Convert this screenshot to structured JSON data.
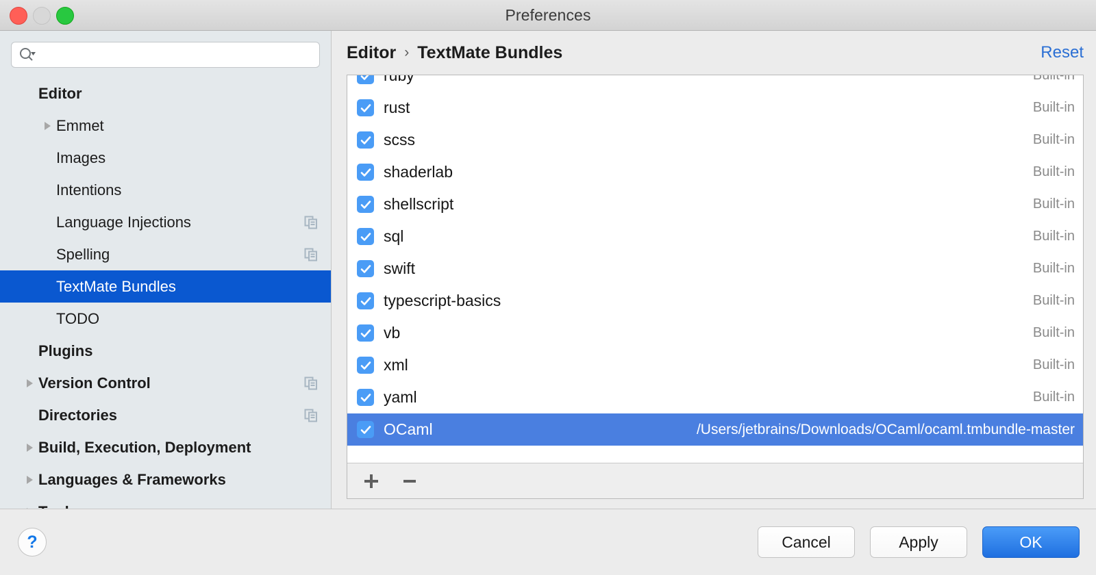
{
  "window": {
    "title": "Preferences",
    "traffic_lights": [
      "close-button",
      "minimize-button",
      "zoom-button"
    ]
  },
  "sidebar": {
    "search": {
      "value": "",
      "placeholder": ""
    },
    "items": [
      {
        "label": "Editor",
        "bold": true,
        "indent": 0,
        "twisty": false,
        "copy": false,
        "selected": false
      },
      {
        "label": "Emmet",
        "bold": false,
        "indent": 1,
        "twisty": true,
        "copy": false,
        "selected": false
      },
      {
        "label": "Images",
        "bold": false,
        "indent": 1,
        "twisty": false,
        "copy": false,
        "selected": false
      },
      {
        "label": "Intentions",
        "bold": false,
        "indent": 1,
        "twisty": false,
        "copy": false,
        "selected": false
      },
      {
        "label": "Language Injections",
        "bold": false,
        "indent": 1,
        "twisty": false,
        "copy": true,
        "selected": false
      },
      {
        "label": "Spelling",
        "bold": false,
        "indent": 1,
        "twisty": false,
        "copy": true,
        "selected": false
      },
      {
        "label": "TextMate Bundles",
        "bold": false,
        "indent": 1,
        "twisty": false,
        "copy": false,
        "selected": true
      },
      {
        "label": "TODO",
        "bold": false,
        "indent": 1,
        "twisty": false,
        "copy": false,
        "selected": false
      },
      {
        "label": "Plugins",
        "bold": true,
        "indent": 0,
        "twisty": false,
        "copy": false,
        "selected": false
      },
      {
        "label": "Version Control",
        "bold": true,
        "indent": 0,
        "twisty": true,
        "copy": true,
        "selected": false
      },
      {
        "label": "Directories",
        "bold": true,
        "indent": 0,
        "twisty": false,
        "copy": true,
        "selected": false
      },
      {
        "label": "Build, Execution, Deployment",
        "bold": true,
        "indent": 0,
        "twisty": true,
        "copy": false,
        "selected": false
      },
      {
        "label": "Languages & Frameworks",
        "bold": true,
        "indent": 0,
        "twisty": true,
        "copy": false,
        "selected": false
      },
      {
        "label": "Tools",
        "bold": true,
        "indent": 0,
        "twisty": true,
        "copy": false,
        "selected": false
      }
    ]
  },
  "breadcrumb": {
    "parent": "Editor",
    "separator": "›",
    "current": "TextMate Bundles",
    "reset_label": "Reset"
  },
  "bundles": {
    "builtin_label": "Built-in",
    "rows": [
      {
        "name": "ruby",
        "checked": true,
        "meta": "Built-in",
        "selected": false
      },
      {
        "name": "rust",
        "checked": true,
        "meta": "Built-in",
        "selected": false
      },
      {
        "name": "scss",
        "checked": true,
        "meta": "Built-in",
        "selected": false
      },
      {
        "name": "shaderlab",
        "checked": true,
        "meta": "Built-in",
        "selected": false
      },
      {
        "name": "shellscript",
        "checked": true,
        "meta": "Built-in",
        "selected": false
      },
      {
        "name": "sql",
        "checked": true,
        "meta": "Built-in",
        "selected": false
      },
      {
        "name": "swift",
        "checked": true,
        "meta": "Built-in",
        "selected": false
      },
      {
        "name": "typescript-basics",
        "checked": true,
        "meta": "Built-in",
        "selected": false
      },
      {
        "name": "vb",
        "checked": true,
        "meta": "Built-in",
        "selected": false
      },
      {
        "name": "xml",
        "checked": true,
        "meta": "Built-in",
        "selected": false
      },
      {
        "name": "yaml",
        "checked": true,
        "meta": "Built-in",
        "selected": false
      },
      {
        "name": "OCaml",
        "checked": true,
        "meta": "/Users/jetbrains/Downloads/OCaml/ocaml.tmbundle-master",
        "selected": true
      }
    ],
    "toolbar": {
      "add_label": "+",
      "remove_label": "−"
    }
  },
  "footer": {
    "help_label": "?",
    "cancel_label": "Cancel",
    "apply_label": "Apply",
    "ok_label": "OK"
  },
  "colors": {
    "sidebar_selection": "#0a58d0",
    "row_selection": "#4a7fe0",
    "checkbox": "#4a9cf6",
    "link": "#2b6fd4",
    "default_button": "#1f6fe0"
  }
}
